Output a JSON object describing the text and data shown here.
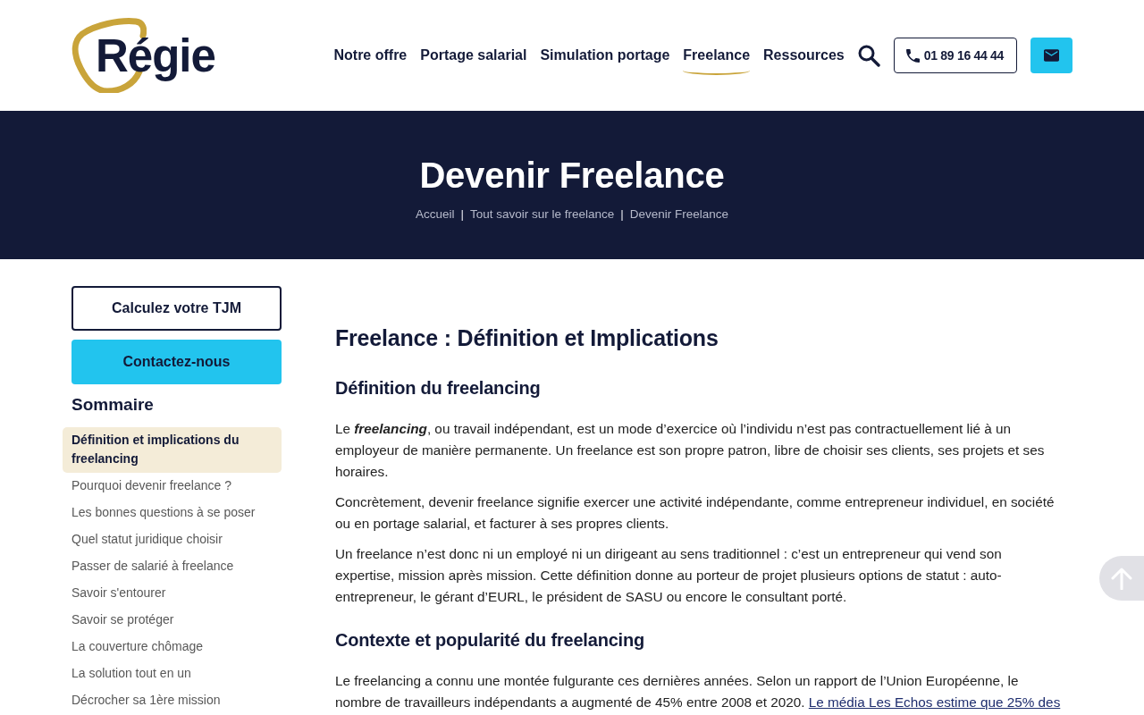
{
  "header": {
    "logo": "Régie",
    "nav": [
      {
        "label": "Notre offre",
        "selected": false
      },
      {
        "label": "Portage salarial",
        "selected": false
      },
      {
        "label": "Simulation portage",
        "selected": false
      },
      {
        "label": "Freelance",
        "selected": true
      },
      {
        "label": "Ressources",
        "selected": false
      }
    ],
    "phone": "01 89 16 44 44"
  },
  "hero": {
    "title": "Devenir Freelance",
    "breadcrumb": {
      "items": [
        "Accueil",
        "Tout savoir sur le freelance",
        "Devenir Freelance"
      ],
      "separator": "|"
    }
  },
  "sidebar": {
    "buttons": [
      {
        "label": "Calculez votre TJM",
        "kind": "outline"
      },
      {
        "label": "Contactez-nous",
        "kind": "filled"
      }
    ],
    "summary_title": "Sommaire",
    "summary_items": [
      {
        "label": "Définition et implications du freelancing",
        "selected": true
      },
      {
        "label": "Pourquoi devenir freelance ?",
        "selected": false
      },
      {
        "label": "Les bonnes questions à se poser",
        "selected": false
      },
      {
        "label": "Quel statut juridique choisir",
        "selected": false
      },
      {
        "label": "Passer de salarié à freelance",
        "selected": false
      },
      {
        "label": "Savoir s'entourer",
        "selected": false
      },
      {
        "label": "Savoir se protéger",
        "selected": false
      },
      {
        "label": "La couverture chômage",
        "selected": false
      },
      {
        "label": "La solution tout en un",
        "selected": false
      },
      {
        "label": "Décrocher sa 1ère mission",
        "selected": false
      }
    ]
  },
  "article": {
    "title": "Freelance : Définition et Implications",
    "blocks": [
      {
        "kind": "heading",
        "text": "Définition du freelancing"
      },
      {
        "kind": "paragraph",
        "text": "Le *freelancing*, ou travail indépendant, est un mode d’exercice où l’individu n’est pas contractuellement lié à un employeur de manière permanente. Un freelance est son propre patron, libre de choisir ses clients, ses projets et ses horaires."
      },
      {
        "kind": "paragraph",
        "text": "Concrètement, devenir freelance signifie exercer une activité indépendante, comme entrepreneur individuel, en société ou en portage salarial, et facturer à ses propres clients."
      },
      {
        "kind": "paragraph",
        "text": "Un freelance n’est donc ni un employé ni un dirigeant au sens traditionnel : c’est un entrepreneur qui vend son expertise, mission après mission. Cette définition donne au porteur de projet plusieurs options de statut : auto-entrepreneur, le gérant d’EURL, le président de SASU ou encore le consultant porté."
      },
      {
        "kind": "heading",
        "text": "Contexte et popularité du freelancing"
      },
      {
        "kind": "paragraph",
        "text": "Le freelancing a connu une montée fulgurante ces dernières années. Selon un rapport de l’Union Européenne, le nombre de travailleurs indépendants a augmenté de 45% entre 2008 et 2020.",
        "link": "Le média Les Echos estime que 25% des"
      }
    ]
  }
}
